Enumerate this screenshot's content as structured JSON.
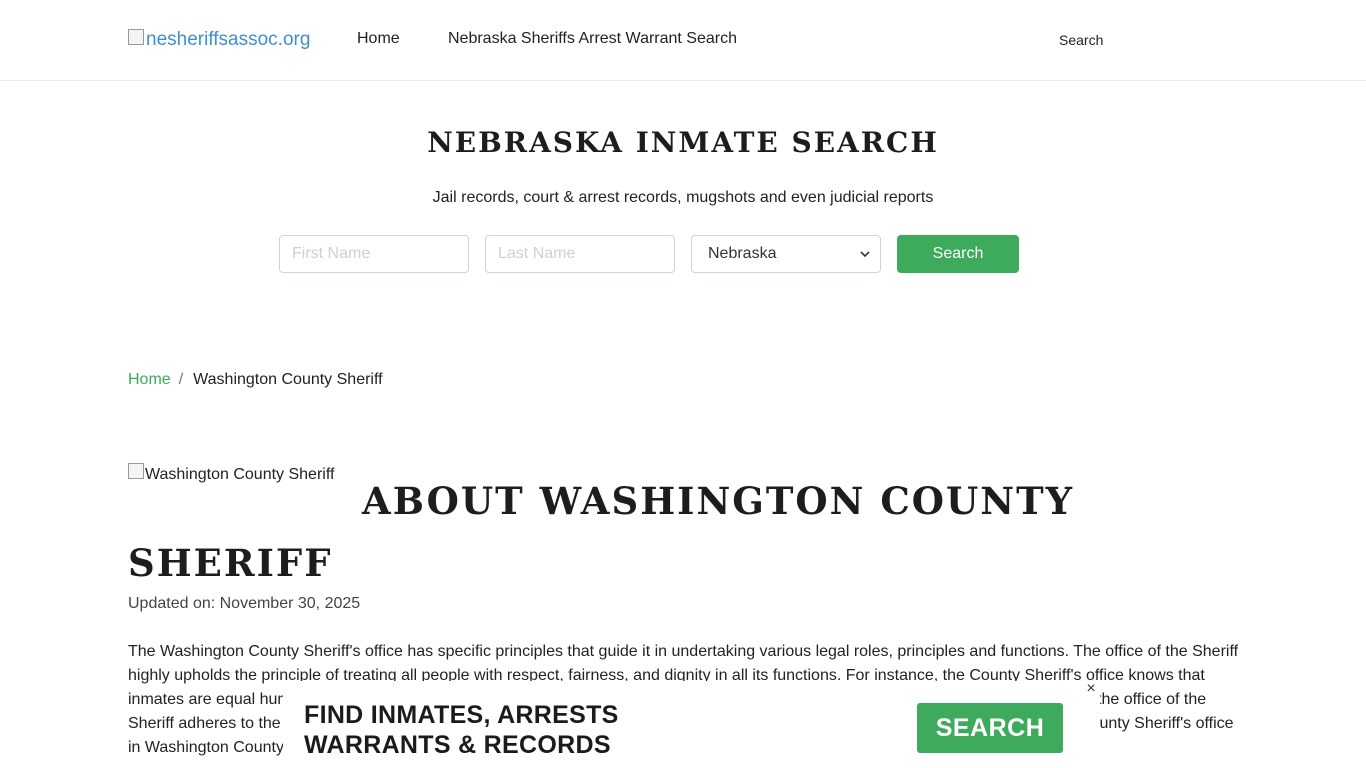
{
  "header": {
    "logo_alt": "nesheriffsassoc.org",
    "nav": {
      "home": "Home",
      "warrant_search": "Nebraska Sheriffs Arrest Warrant Search",
      "search": "Search"
    }
  },
  "hero": {
    "title": "NEBRASKA INMATE SEARCH",
    "subtitle": "Jail records, court & arrest records, mugshots and even judicial reports",
    "first_name_placeholder": "First Name",
    "last_name_placeholder": "Last Name",
    "state_selected": "Nebraska",
    "search_button": "Search"
  },
  "breadcrumb": {
    "home": "Home",
    "separator": "/",
    "current": "Washington County Sheriff"
  },
  "article": {
    "image_alt": "Washington County Sheriff",
    "title": "About Washington County Sheriff",
    "updated": "Updated on: November 30, 2025",
    "body": "The Washington County Sheriff's office has specific principles that guide it in undertaking various legal roles, principles and functions. The office of the Sheriff highly upholds the principle of treating all people with respect, fairness, and dignity in all its functions. For instance, the County Sheriff's office knows that inmates are equal human beings and treats them with dignity and respect as it works to help the criminals in reforming. Most importantly, the office of the Sheriff adheres to the law as it works to enforce the law and makes sure to bring to justice all those who break the law. This is why the County Sheriff's office in Washington County"
  },
  "banner": {
    "text": "FIND INMATES, ARRESTS WARRANTS & RECORDS",
    "button": "SEARCH",
    "close": "×"
  },
  "colors": {
    "accent_green": "#3daa5c",
    "logo_link_blue": "#3f8fd0"
  }
}
